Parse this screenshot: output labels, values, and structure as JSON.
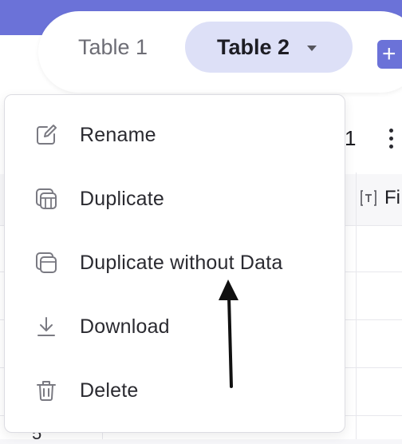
{
  "tabs": [
    {
      "label": "Table 1",
      "active": false
    },
    {
      "label": "Table 2",
      "active": true
    }
  ],
  "add_button": {
    "label": "+"
  },
  "record_count": "1",
  "column_header": {
    "icon": "text-field-icon",
    "label": "Fi"
  },
  "row_number": "5",
  "menu": {
    "items": [
      {
        "label": "Rename",
        "icon": "rename-icon"
      },
      {
        "label": "Duplicate",
        "icon": "duplicate-icon"
      },
      {
        "label": "Duplicate without Data",
        "icon": "duplicate-without-data-icon"
      },
      {
        "label": "Download",
        "icon": "download-icon"
      },
      {
        "label": "Delete",
        "icon": "trash-icon"
      }
    ]
  },
  "colors": {
    "accent": "#6b72d8",
    "active_tab": "#dde0f7"
  }
}
